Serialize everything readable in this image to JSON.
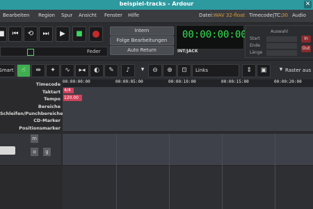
{
  "window": {
    "title": "beispiel-tracks - Ardour"
  },
  "menu": {
    "items": [
      "Bearbeiten",
      "Region",
      "Spur",
      "Ansicht",
      "Fenster",
      "Hilfe"
    ]
  },
  "status": {
    "file_label": "Datei:",
    "file_value": "WAV 32-float",
    "timecode_label": "Timecode|TC:",
    "timecode_value": "30",
    "audio_label": "Audio"
  },
  "transport": {
    "feder_label": "Feder",
    "intern_label": "Intern",
    "folge_label": "Folge Bearbeitungen",
    "autoreturn_label": "Auto Return",
    "clock": "00:00:00:00",
    "int_jack": "INT/JACK"
  },
  "loop": {
    "title": "Auswahl",
    "start": "Start",
    "ende": "Ende",
    "laenge": "Länge",
    "in": "In",
    "out": "Out"
  },
  "toolbar": {
    "mode": "Smart",
    "align": "Links",
    "grid": "Raster aus"
  },
  "rulers": {
    "labels": [
      "Timecode",
      "Taktart",
      "Tempo",
      "Bereiche",
      "Schleifen/Punchbereiche",
      "CD-Marker",
      "Positionsmarker"
    ],
    "ticks": [
      "00:00:00:00",
      "00:00:05:00",
      "00:00:10:00",
      "00:00:15:00",
      "00:00:20:00"
    ],
    "meter": "4/4",
    "tempo": "120.00"
  },
  "track": {
    "m_label": "m",
    "o_label": "o",
    "g_label": "g"
  },
  "colors": {
    "accent": "#2d9aa0",
    "clock": "#32e052",
    "record": "#c62a2a",
    "marker": "#d0425c"
  }
}
